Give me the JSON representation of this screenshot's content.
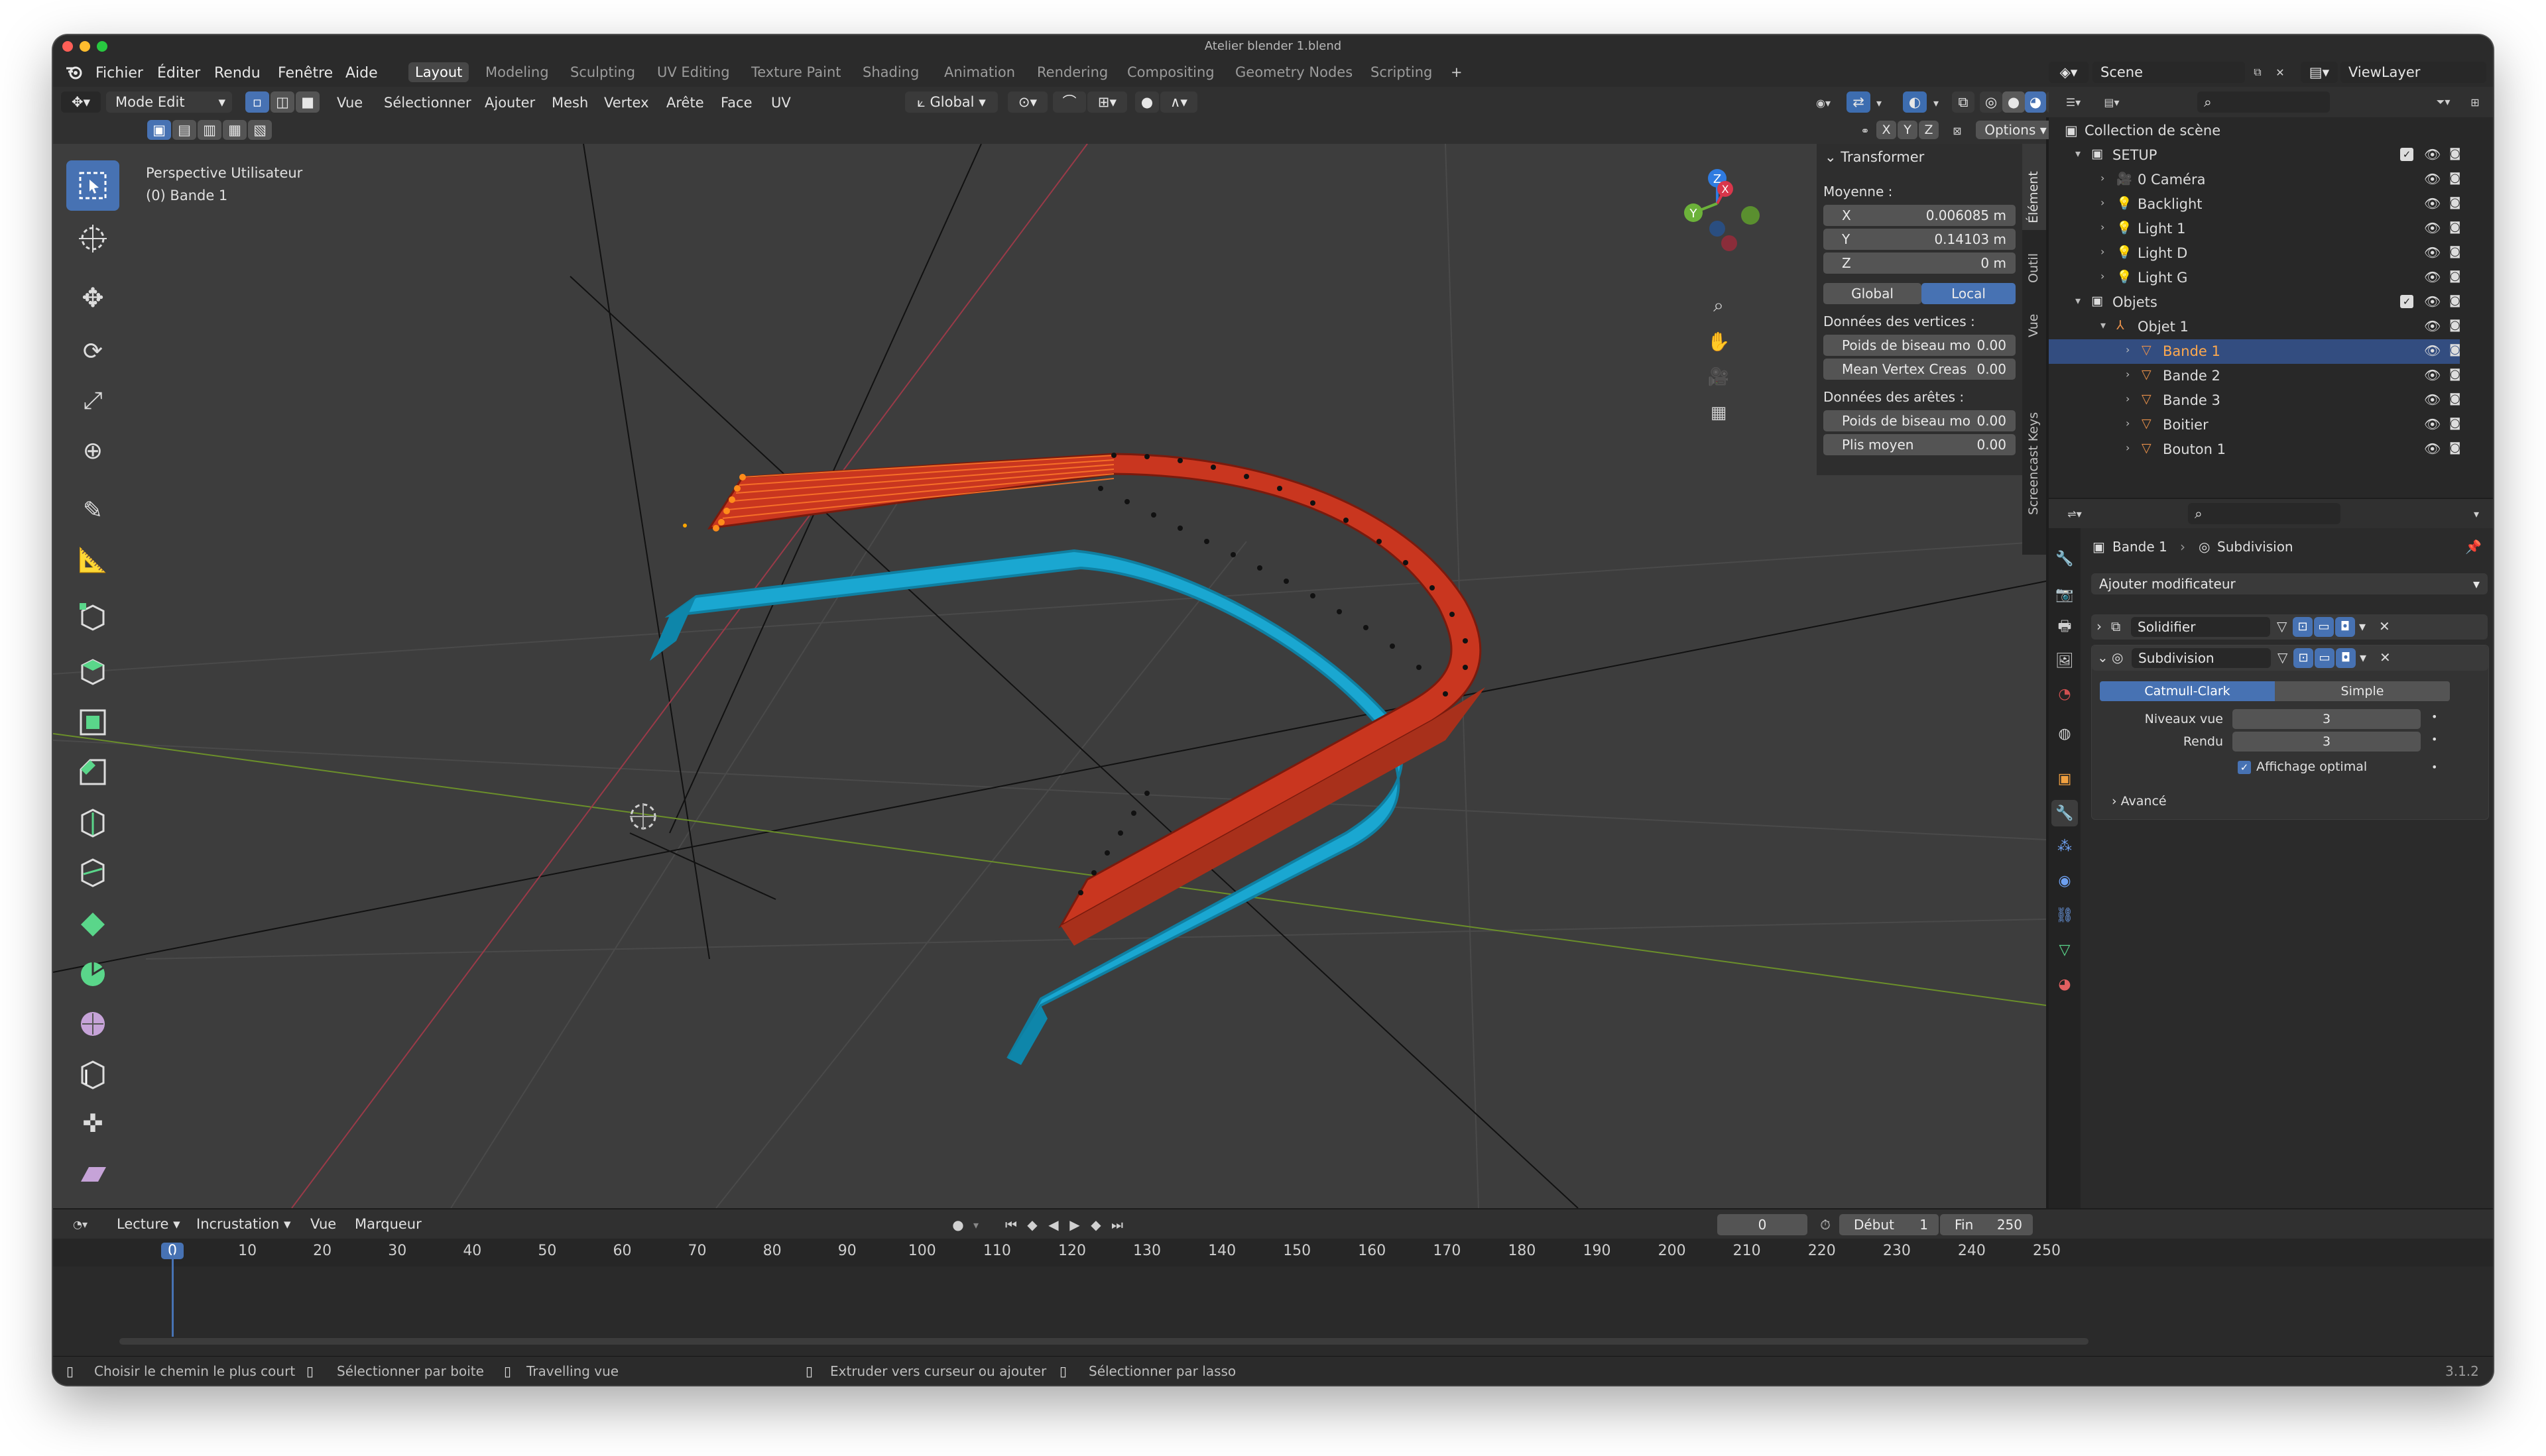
{
  "window": {
    "title": "Atelier blender 1.blend"
  },
  "menu": [
    "Fichier",
    "Éditer",
    "Rendu",
    "Fenêtre",
    "Aide"
  ],
  "workspaces": [
    "Layout",
    "Modeling",
    "Sculpting",
    "UV Editing",
    "Texture Paint",
    "Shading",
    "Animation",
    "Rendering",
    "Compositing",
    "Geometry Nodes",
    "Scripting"
  ],
  "workspace_add": "+",
  "scene": {
    "label": "Scene",
    "view_layer": "ViewLayer"
  },
  "viewport_header": {
    "mode": "Mode Edit",
    "menus": [
      "Vue",
      "Sélectionner",
      "Ajouter",
      "Mesh",
      "Vertex",
      "Arête",
      "Face",
      "UV"
    ],
    "orientation": "Global",
    "axes": [
      "X",
      "Y",
      "Z"
    ],
    "options": "Options"
  },
  "overlay_text": {
    "perspective": "Perspective Utilisateur",
    "object": "(0) Bande 1"
  },
  "npanel": {
    "section": "Transformer",
    "median_label": "Moyenne :",
    "fields": [
      {
        "label": "X",
        "value": "0.006085 m"
      },
      {
        "label": "Y",
        "value": "0.14103 m"
      },
      {
        "label": "Z",
        "value": "0 m"
      }
    ],
    "space_global": "Global",
    "space_local": "Local",
    "vertex_data_label": "Données des vertices :",
    "vertex_fields": [
      {
        "label": "Poids de biseau mo",
        "value": "0.00"
      },
      {
        "label": "Mean Vertex Creas",
        "value": "0.00"
      }
    ],
    "edge_data_label": "Données des arêtes :",
    "edge_fields": [
      {
        "label": "Poids de biseau mo",
        "value": "0.00"
      },
      {
        "label": "Plis moyen",
        "value": "0.00"
      }
    ],
    "tabs": [
      "Élément",
      "Outil",
      "Vue",
      "Screencast Keys"
    ]
  },
  "outliner": {
    "root": "Collection de scène",
    "rows": [
      {
        "name": "SETUP",
        "depth": 0,
        "kind": "collection"
      },
      {
        "name": "0 Caméra",
        "depth": 1,
        "kind": "camera"
      },
      {
        "name": "Backlight",
        "depth": 1,
        "kind": "light"
      },
      {
        "name": "Light 1",
        "depth": 1,
        "kind": "light"
      },
      {
        "name": "Light D",
        "depth": 1,
        "kind": "light"
      },
      {
        "name": "Light G",
        "depth": 1,
        "kind": "light"
      },
      {
        "name": "Objets",
        "depth": 0,
        "kind": "collection"
      },
      {
        "name": "Objet 1",
        "depth": 1,
        "kind": "empty"
      },
      {
        "name": "Bande 1",
        "depth": 2,
        "kind": "mesh",
        "selected": true
      },
      {
        "name": "Bande 2",
        "depth": 2,
        "kind": "mesh"
      },
      {
        "name": "Bande 3",
        "depth": 2,
        "kind": "mesh"
      },
      {
        "name": "Boitier",
        "depth": 2,
        "kind": "mesh"
      },
      {
        "name": "Bouton 1",
        "depth": 2,
        "kind": "mesh"
      }
    ]
  },
  "properties": {
    "breadcrumb_object": "Bande 1",
    "breadcrumb_modifier": "Subdivision",
    "add_modifier": "Ajouter modificateur",
    "modifiers": [
      {
        "name": "Solidifier",
        "expanded": false
      },
      {
        "name": "Subdivision",
        "expanded": true
      }
    ],
    "subdiv_types": [
      "Catmull-Clark",
      "Simple"
    ],
    "levels_view_label": "Niveaux vue",
    "levels_view": "3",
    "render_label": "Rendu",
    "render_levels": "3",
    "optimal_display": "Affichage optimal",
    "advanced": "Avancé"
  },
  "timeline": {
    "menus": [
      "Lecture",
      "Incrustation",
      "Vue",
      "Marqueur"
    ],
    "current_frame": "0",
    "start_label": "Début",
    "start": "1",
    "end_label": "Fin",
    "end": "250",
    "ticks": [
      "0",
      "10",
      "20",
      "30",
      "40",
      "50",
      "60",
      "70",
      "80",
      "90",
      "100",
      "110",
      "120",
      "130",
      "140",
      "150",
      "160",
      "170",
      "180",
      "190",
      "200",
      "210",
      "220",
      "230",
      "240",
      "250"
    ]
  },
  "statusbar": {
    "hints": [
      "Choisir le chemin le plus court",
      "Sélectionner par boite",
      "Travelling vue",
      "Extruder vers curseur ou ajouter",
      "Sélectionner par lasso"
    ],
    "version": "3.1.2"
  },
  "colors": {
    "accent": "#4772b3",
    "red_object": "#c9361f",
    "blue_object": "#1aa7d1",
    "selected_row": "#334d80"
  }
}
